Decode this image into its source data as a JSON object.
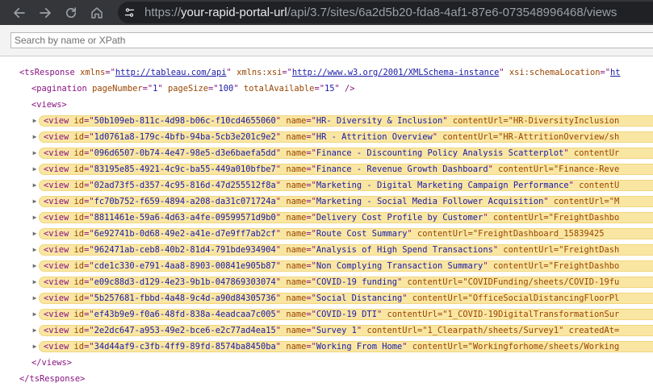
{
  "browser": {
    "url_scheme": "https://",
    "url_host": "your-rapid-portal-url",
    "url_path": "/api/3.7/sites/6a2d5b20-fda8-4af1-87e6-073548996468/views",
    "icons": [
      "back-arrow-icon",
      "forward-arrow-icon",
      "reload-icon",
      "home-icon",
      "site-info-icon"
    ]
  },
  "search": {
    "placeholder": "Search by name or XPath",
    "value": ""
  },
  "xml": {
    "root_open": "<tsResponse",
    "ns_attr": "xmlns",
    "ns_value": "http://tableau.com/api",
    "xsi_attr": "xmlns:xsi",
    "xsi_value": "http://www.w3.org/2001/XMLSchema-instance",
    "loc_attr": "xsi:schemaLocation",
    "loc_value": "ht",
    "pagination_tag": "<pagination",
    "page_number": "1",
    "page_size": "100",
    "total_available": "15",
    "views_open": "<views>",
    "views_close": "</views>",
    "root_close": "</tsResponse>",
    "views": [
      {
        "id": "50b109eb-811c-4d98-b06c-f10cd4655060",
        "name": "HR- Diversity & Inclusion",
        "tail": "contentUrl=\"HR-DiversityInclusion"
      },
      {
        "id": "1d0761a8-179c-4bfb-94ba-5cb3e201c9e2",
        "name": "HR - Attrition Overview",
        "tail": "contentUrl=\"HR-AttritionOverview/sh"
      },
      {
        "id": "096d6507-0b74-4e47-98e5-d3e6baefa5dd",
        "name": "Finance - Discounting Policy Analysis Scatterplot",
        "tail": "contentUr"
      },
      {
        "id": "83195e85-4921-4c9c-ba55-449a010bfbe7",
        "name": "Finance - Revenue Growth Dashboard",
        "tail": "contentUrl=\"Finance-Reve"
      },
      {
        "id": "02ad73f5-d357-4c95-816d-47d255512f8a",
        "name": "Marketing - Digital Marketing Campaign Performance",
        "tail": "contentU"
      },
      {
        "id": "fc70b752-f659-4894-a208-da31c071724a",
        "name": "Marketing - Social Media Follower Acquisition",
        "tail": "contentUrl=\"M"
      },
      {
        "id": "8811461e-59a6-4d63-a4fe-09599571d9b0",
        "name": "Delivery Cost Profile by Customer",
        "tail": "contentUrl=\"FreightDashbo"
      },
      {
        "id": "6e92741b-0d68-49e2-a41e-d7e9ff7ab2cf",
        "name": "Route Cost Summary",
        "tail": "contentUrl=\"FreightDashboard_15839425"
      },
      {
        "id": "962471ab-ceb8-40b2-81d4-791bde934904",
        "name": "Analysis of High Spend Transactions",
        "tail": "contentUrl=\"FreightDash"
      },
      {
        "id": "cde1c330-e791-4aa8-8903-00841e905b87",
        "name": "Non Complying Transaction Summary",
        "tail": "contentUrl=\"FreightDashbo"
      },
      {
        "id": "e09c88d3-d129-4e23-9b1b-047869303074",
        "name": "COVID-19 funding",
        "tail": "contentUrl=\"COVIDFunding/sheets/COVID-19fu"
      },
      {
        "id": "5b257681-fbbd-4a48-9c4d-a90d84305736",
        "name": "Social Distancing",
        "tail": "contentUrl=\"OfficeSocialDistancingFloorPl"
      },
      {
        "id": "ef43b9e9-f0a6-48fd-838a-4eadcaa7c005",
        "name": "COVID-19 DTI",
        "tail": "contentUrl=\"1_COVID-19DigitalTransformationSur"
      },
      {
        "id": "2e2dc647-a953-49e2-bce6-e2c77ad4ea15",
        "name": "Survey 1",
        "tail": "contentUrl=\"1_Clearpath/sheets/Survey1\" createdAt="
      },
      {
        "id": "34d44af9-c3fb-4ff9-89fd-8574ba8450ba",
        "name": "Working From Home",
        "tail": "contentUrl=\"Workingforhome/sheets/Working"
      }
    ]
  },
  "colors": {
    "chrome_bg": "#35363a",
    "omnibox_bg": "#202124",
    "tag": "#881280",
    "attr": "#994500",
    "value": "#1a1aa6",
    "highlight": "#f9e6a3"
  }
}
